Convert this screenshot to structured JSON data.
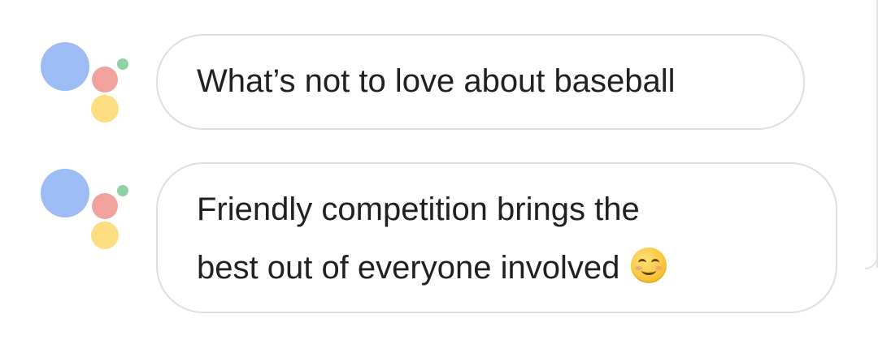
{
  "assistant_logo": {
    "colors": {
      "blue": "#9dbcf5",
      "red": "#f1a29a",
      "yellow": "#fcdd82",
      "green": "#8fd1a3"
    }
  },
  "messages": [
    {
      "lines": [
        "What’s not to love about baseball"
      ],
      "emoji": null
    },
    {
      "lines": [
        "Friendly competition brings the",
        "best out of everyone involved"
      ],
      "emoji": "smiling-face-with-smiling-eyes"
    }
  ]
}
